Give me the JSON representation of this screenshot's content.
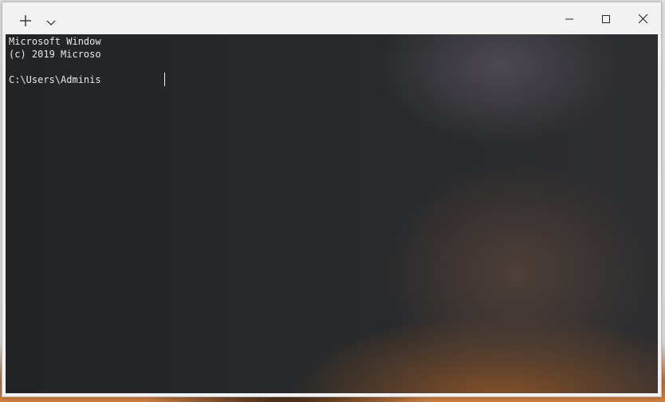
{
  "window": {
    "controls": {
      "new_tab_icon": "plus-icon",
      "dropdown_icon": "chevron-down-icon",
      "minimize_icon": "minimize-icon",
      "maximize_icon": "maximize-icon",
      "close_icon": "close-icon"
    },
    "colors": {
      "titlebar": "#f2f2f2",
      "terminal_text": "#e8e8e8"
    }
  },
  "terminal": {
    "lines": [
      "Microsoft Window",
      "(c) 2019 Microso",
      "",
      "C:\\Users\\Adminis"
    ]
  }
}
